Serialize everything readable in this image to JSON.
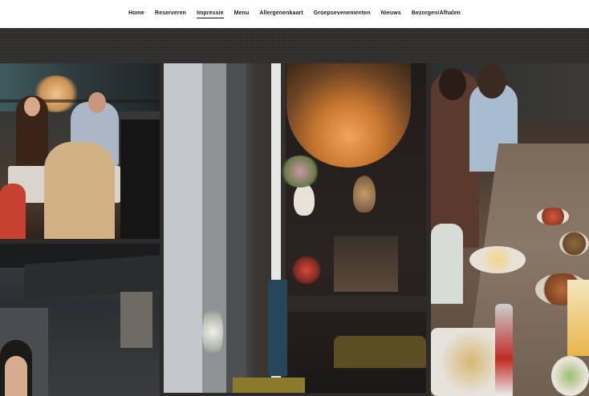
{
  "nav": {
    "items": [
      {
        "label": "Home",
        "active": false
      },
      {
        "label": "Reserveren",
        "active": false
      },
      {
        "label": "Impressie",
        "active": true
      },
      {
        "label": "Menu",
        "active": false
      },
      {
        "label": "Allergenenkaart",
        "active": false
      },
      {
        "label": "Groepsevenementen",
        "active": false
      },
      {
        "label": "Nieuws",
        "active": false
      },
      {
        "label": "Bezorgen/Afhalen",
        "active": false
      }
    ]
  }
}
